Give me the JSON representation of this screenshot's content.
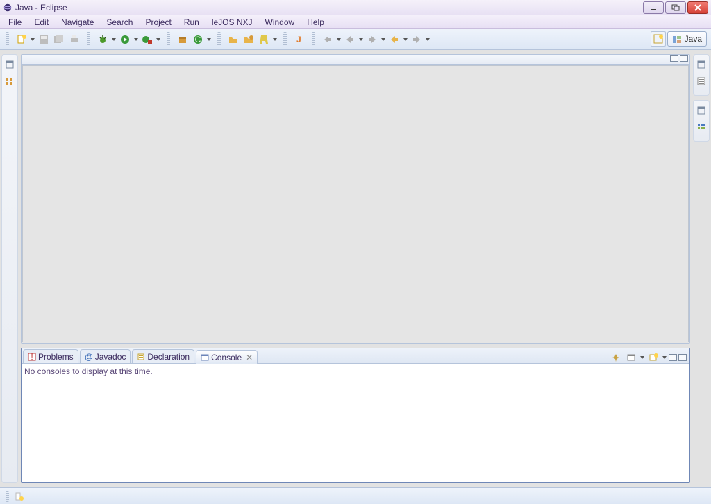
{
  "window": {
    "title": "Java - Eclipse"
  },
  "menu": [
    "File",
    "Edit",
    "Navigate",
    "Search",
    "Project",
    "Run",
    "leJOS NXJ",
    "Window",
    "Help"
  ],
  "perspective": {
    "label": "Java"
  },
  "bottom": {
    "tabs": [
      {
        "label": "Problems"
      },
      {
        "label": "Javadoc"
      },
      {
        "label": "Declaration"
      },
      {
        "label": "Console",
        "active": true
      }
    ],
    "console_message": "No consoles to display at this time."
  }
}
